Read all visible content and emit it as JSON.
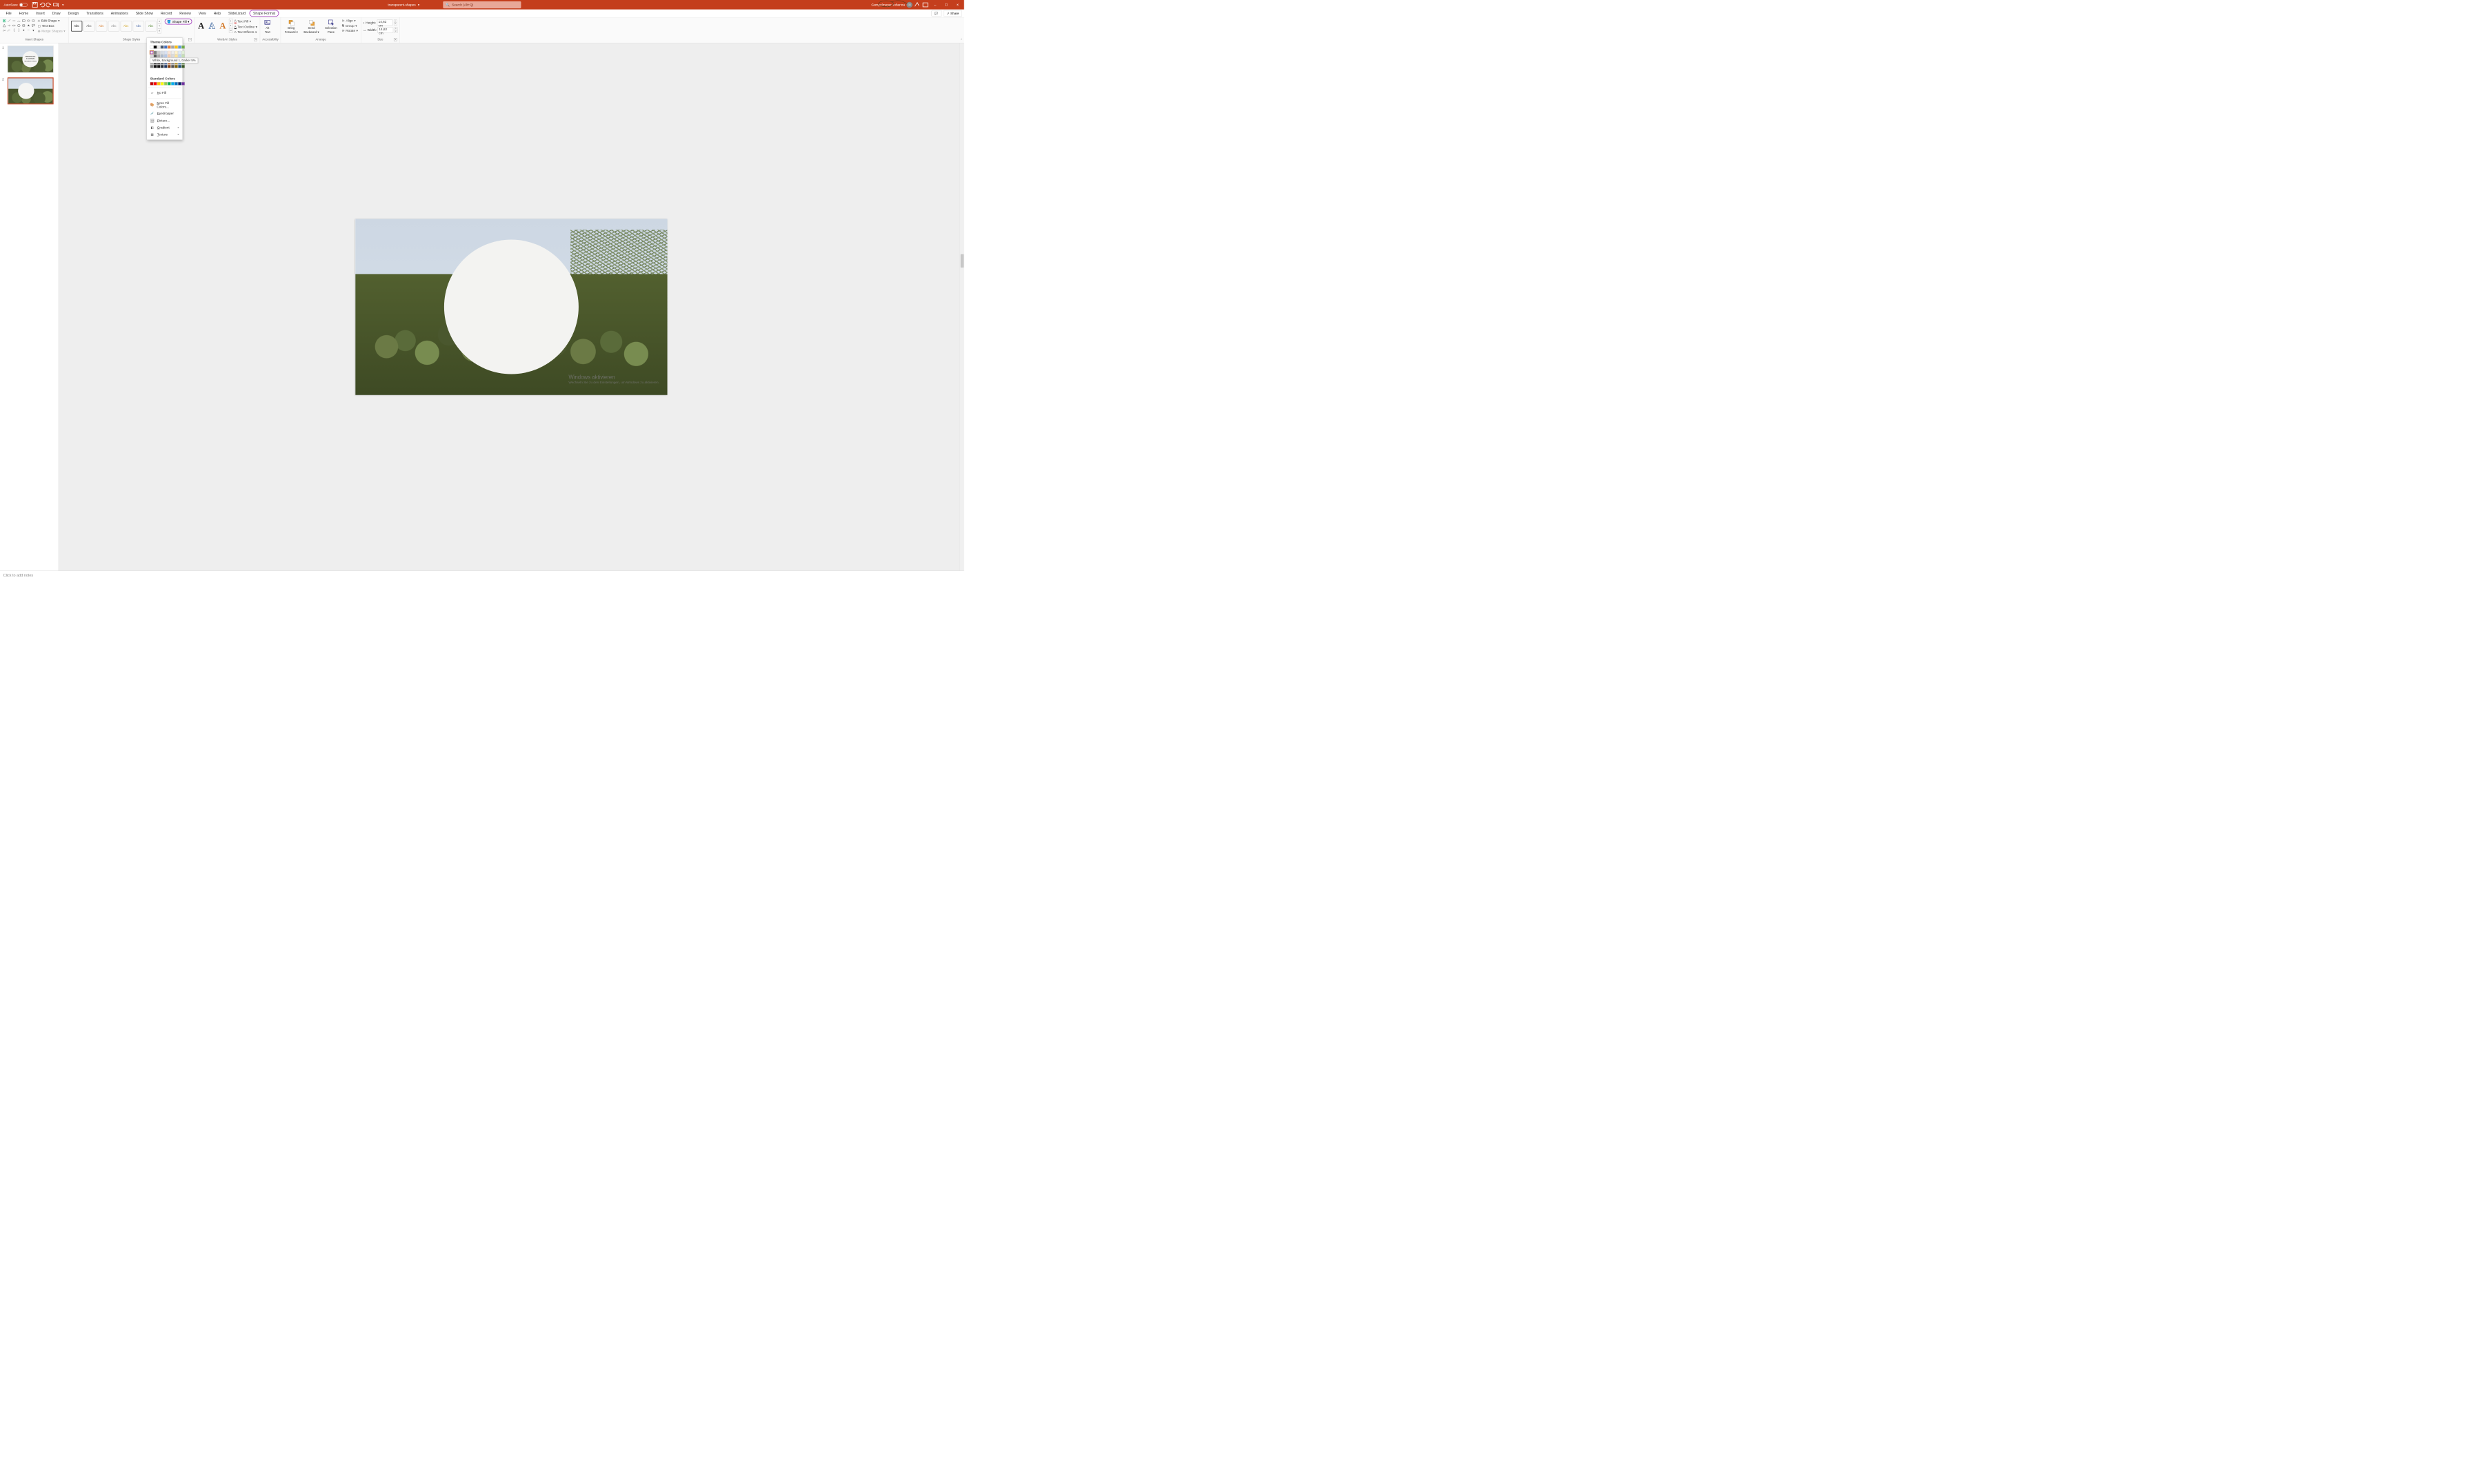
{
  "titlebar": {
    "autosave_label": "AutoSave",
    "autosave_state": "Off",
    "doc_name": "transparent-shapes",
    "search_placeholder": "Search (Alt+Q)",
    "user_name": "Gumpelmeyer Johanna",
    "user_initials": "GJ"
  },
  "tabs": [
    "File",
    "Home",
    "Insert",
    "Draw",
    "Design",
    "Transitions",
    "Animations",
    "Slide Show",
    "Record",
    "Review",
    "View",
    "Help",
    "SlideLizard",
    "Shape Format"
  ],
  "active_tab": "Shape Format",
  "share": {
    "label": "Share",
    "comments_tip": "Comments"
  },
  "ribbon": {
    "insert_shapes": {
      "group_label": "Insert Shapes",
      "edit_shape": "Edit Shape",
      "text_box": "Text Box",
      "merge_shapes": "Merge Shapes"
    },
    "shape_styles": {
      "group_label": "Shape Styles",
      "style_label": "Abc",
      "shape_fill": "Shape Fill"
    },
    "wordart": {
      "group_label": "WordArt Styles",
      "text_fill": "Text Fill",
      "text_outline": "Text Outline",
      "text_effects": "Text Effects"
    },
    "accessibility": {
      "group_label": "Accessibility",
      "alt_text_line1": "Alt",
      "alt_text_line2": "Text"
    },
    "arrange": {
      "group_label": "Arrange",
      "bring_forward_line1": "Bring",
      "bring_forward_line2": "Forward",
      "send_backward_line1": "Send",
      "send_backward_line2": "Backward",
      "selection_pane_line1": "Selection",
      "selection_pane_line2": "Pane",
      "align": "Align",
      "group": "Group",
      "rotate": "Rotate"
    },
    "size": {
      "group_label": "Size",
      "height_label": "Height:",
      "width_label": "Width:",
      "height_value": "14,62 cm",
      "width_value": "14,62 cm"
    }
  },
  "fill_dropdown": {
    "theme_colors_label": "Theme Colors",
    "standard_colors_label": "Standard Colors",
    "tooltip": "White, Background 1, Darker 5%",
    "theme_row1": [
      "#ffffff",
      "#000000",
      "#e7e6e6",
      "#44546a",
      "#4472c4",
      "#ed7d31",
      "#a5a5a5",
      "#ffc000",
      "#5b9bd5",
      "#70ad47"
    ],
    "theme_shades": [
      [
        "#f2f2f2",
        "#808080",
        "#d0cece",
        "#d6dce5",
        "#d9e2f3",
        "#fbe5d6",
        "#ededed",
        "#fff2cc",
        "#deebf7",
        "#e2f0d9"
      ],
      [
        "#d9d9d9",
        "#595959",
        "#aeabab",
        "#adb9ca",
        "#b4c7e7",
        "#f7cbac",
        "#dbdbdb",
        "#fee599",
        "#bdd7ee",
        "#c5e0b4"
      ],
      [
        "#bfbfbf",
        "#404040",
        "#757070",
        "#8497b0",
        "#8faadc",
        "#f4b183",
        "#c9c9c9",
        "#ffd966",
        "#9dc3e6",
        "#a9d18e"
      ],
      [
        "#a6a6a6",
        "#262626",
        "#3b3838",
        "#323f4f",
        "#2f5597",
        "#c55a11",
        "#7b7b7b",
        "#bf9000",
        "#2e75b6",
        "#548235"
      ],
      [
        "#7f7f7f",
        "#0d0d0d",
        "#171616",
        "#222a35",
        "#1f3864",
        "#843c0c",
        "#525252",
        "#7f6000",
        "#1f4e79",
        "#385723"
      ]
    ],
    "standard_row": [
      "#c00000",
      "#ff0000",
      "#ffc000",
      "#ffff00",
      "#92d050",
      "#00b050",
      "#00b0f0",
      "#0070c0",
      "#002060",
      "#7030a0"
    ],
    "no_fill": "No Fill",
    "more_colors": "More Fill Colors...",
    "eyedropper": "Eyedropper",
    "picture": "Picture...",
    "gradient": "Gradient",
    "texture": "Texture"
  },
  "slide1": {
    "title": "TROPICAL",
    "title2": "LEAVES",
    "sub": "TRANSPARENT SHAPES"
  },
  "watermark": {
    "line1": "Windows aktivieren",
    "line2": "Wechseln Sie zu den Einstellungen, um Windows zu aktivieren."
  },
  "notes_placeholder": "Click to add notes"
}
